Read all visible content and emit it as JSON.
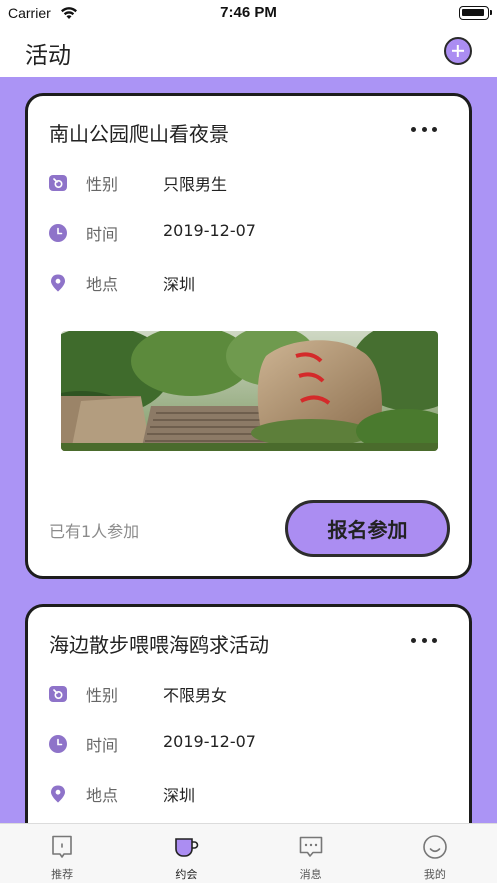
{
  "status_bar": {
    "carrier": "Carrier",
    "time": "7:46 PM",
    "icons": [
      "wifi-icon",
      "battery-icon"
    ]
  },
  "header": {
    "title": "活动",
    "add_icon": "plus-circle-icon"
  },
  "colors": {
    "accent": "#ab8df2",
    "background": "#ab94f5",
    "card_border": "#1d1d1d"
  },
  "cards": [
    {
      "title": "南山公园爬山看夜景",
      "gender_label": "性别",
      "gender_value": "只限男生",
      "time_label": "时间",
      "time_value": "2019-12-07",
      "place_label": "地点",
      "place_value": "深圳",
      "joined_text": "已有1人参加",
      "join_button": "报名参加"
    },
    {
      "title": "海边散步喂喂海鸥求活动",
      "gender_label": "性别",
      "gender_value": "不限男女",
      "time_label": "时间",
      "time_value": "2019-12-07",
      "place_label": "地点",
      "place_value": "深圳"
    }
  ],
  "tabs": [
    {
      "label": "推荐",
      "icon": "bookmark-icon",
      "active": false
    },
    {
      "label": "约会",
      "icon": "coffee-cup-icon",
      "active": true
    },
    {
      "label": "消息",
      "icon": "message-icon",
      "active": false
    },
    {
      "label": "我的",
      "icon": "smile-icon",
      "active": false
    }
  ]
}
